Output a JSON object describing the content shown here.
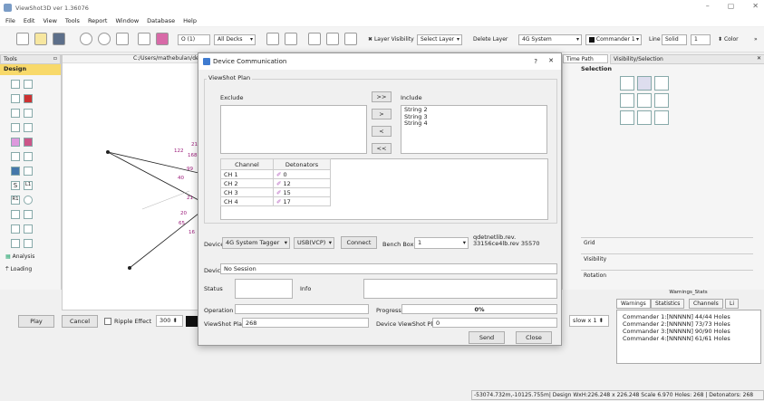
{
  "window": {
    "title": "ViewShot3D ver 1.36076"
  },
  "menu": [
    "File",
    "Edit",
    "View",
    "Tools",
    "Report",
    "Window",
    "Database",
    "Help"
  ],
  "toolbar": {
    "zoom_value": "O (1)",
    "decks_select": "All Decks",
    "layer_visibility": "Layer Visibility",
    "select_layer": "Select Layer",
    "delete_layer": "Delete Layer",
    "system_select": "4G System",
    "commander_select": "Commander 1",
    "line_label": "Line",
    "line_style": "Solid",
    "line_width": "1",
    "color_label": "Color"
  },
  "left_panel": {
    "tools_header": "Tools",
    "design_label": "Design",
    "analysis_label": "Analysis",
    "loading_label": "Loading",
    "tool_labels": [
      "S",
      "L1",
      "R1"
    ]
  },
  "viewport": {
    "path": "C:/Users/mathebulan/de",
    "tags": [
      "122",
      "218",
      "168",
      "99",
      "40",
      "21",
      "20",
      "65",
      "16"
    ]
  },
  "right_panel": {
    "time_path": "Time Path",
    "visibility_selection": "Visibility/Selection",
    "selection_title": "Selection",
    "grid_label": "Grid",
    "visibility_label": "Visibility",
    "rotation_label": "Rotation",
    "warnings_title": "Warnings_Stats",
    "tabs": [
      "Warnings",
      "Statistics",
      "Channels",
      "Li"
    ],
    "warnings": [
      "Commander 1:[NNNNN] 44/44 Holes",
      "Commander 2:[NNNNN] 73/73 Holes",
      "Commander 3:[NNNNN] 90/90 Holes",
      "Commander 4:[NNNNN] 61/61 Holes"
    ]
  },
  "playback": {
    "play": "Play",
    "cancel": "Cancel",
    "ripple_effect": "Ripple Effect",
    "ripple_value": "300",
    "speed": "slow x 1"
  },
  "status_bar": "-53074.732m,-10125.755m| Design WxH:226.248 x 226.248 Scale 6.970  Holes: 268 | Detonators: 268",
  "dialog": {
    "title": "Device Communication",
    "help": "?",
    "close_x": "✕",
    "group_title": "ViewShot Plan",
    "exclude_label": "Exclude",
    "include_label": "Include",
    "include_items": [
      "String 2",
      "String 3",
      "String 4"
    ],
    "move_buttons": [
      ">>",
      ">",
      "<",
      "<<"
    ],
    "table_headers": [
      "Channel",
      "Detonators"
    ],
    "table_rows": [
      {
        "channel": "CH 1",
        "detonators": "0"
      },
      {
        "channel": "CH 2",
        "detonators": "12"
      },
      {
        "channel": "CH 3",
        "detonators": "15"
      },
      {
        "channel": "CH 4",
        "detonators": "17"
      }
    ],
    "device_label": "Device",
    "device_select": "4G System Tagger",
    "port_select": "USB(VCP)",
    "connect": "Connect",
    "bench_box_label": "Bench Box",
    "bench_box_value": "1",
    "version_line1": "qdetnetlib.rev.",
    "version_line2": "33156ce4lb.rev 35570",
    "session_label": "Device",
    "session_value": "No Session",
    "status_label": "Status",
    "info_label": "Info",
    "operation_label": "Operation",
    "progress_label": "Progress",
    "progress_text": "0%",
    "progress_fraction": 0.0,
    "plan_label": "ViewShot Plan",
    "plan_value": "268",
    "device_plan_label": "Device ViewShot Plan",
    "device_plan_value": "0",
    "send": "Send",
    "close": "Close"
  }
}
